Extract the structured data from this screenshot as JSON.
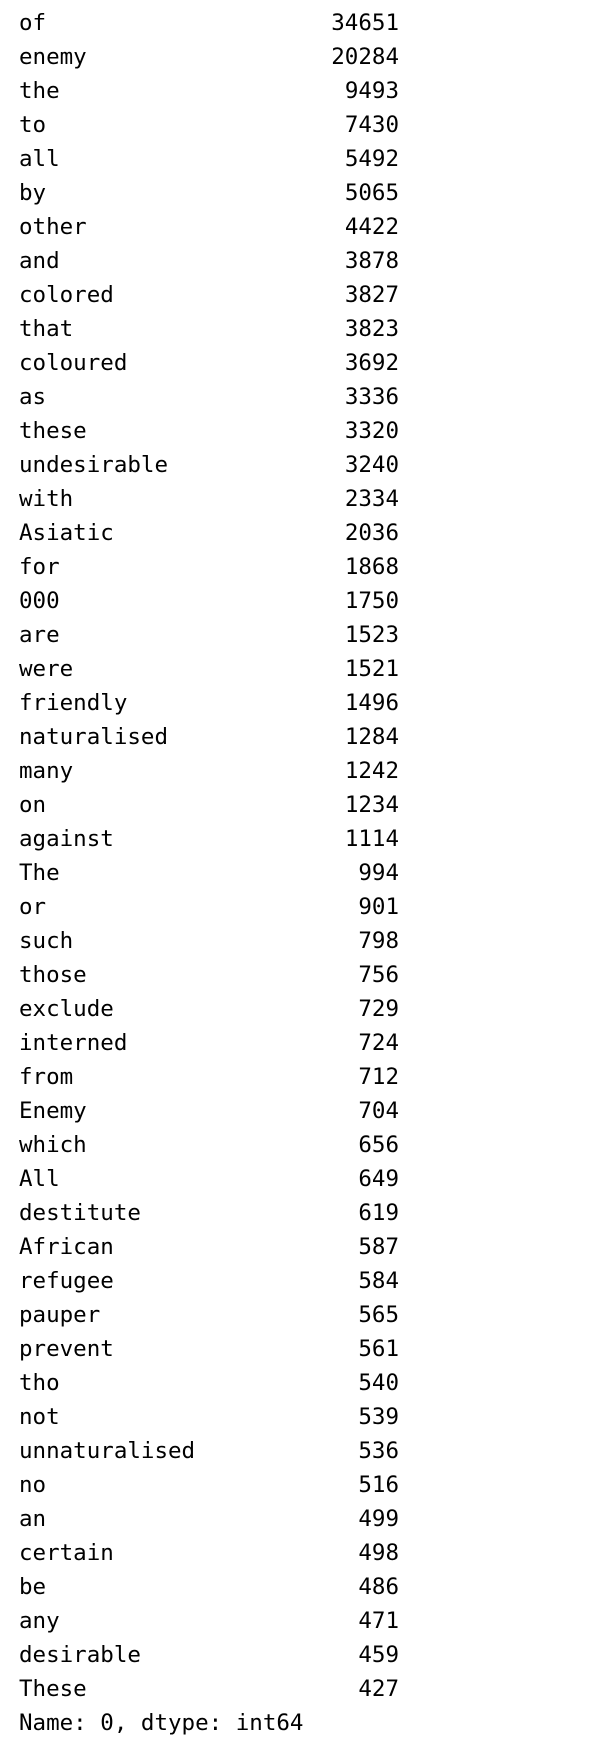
{
  "series": {
    "rows": [
      {
        "word": "of",
        "count": "34651"
      },
      {
        "word": "enemy",
        "count": "20284"
      },
      {
        "word": "the",
        "count": "9493"
      },
      {
        "word": "to",
        "count": "7430"
      },
      {
        "word": "all",
        "count": "5492"
      },
      {
        "word": "by",
        "count": "5065"
      },
      {
        "word": "other",
        "count": "4422"
      },
      {
        "word": "and",
        "count": "3878"
      },
      {
        "word": "colored",
        "count": "3827"
      },
      {
        "word": "that",
        "count": "3823"
      },
      {
        "word": "coloured",
        "count": "3692"
      },
      {
        "word": "as",
        "count": "3336"
      },
      {
        "word": "these",
        "count": "3320"
      },
      {
        "word": "undesirable",
        "count": "3240"
      },
      {
        "word": "with",
        "count": "2334"
      },
      {
        "word": "Asiatic",
        "count": "2036"
      },
      {
        "word": "for",
        "count": "1868"
      },
      {
        "word": "000",
        "count": "1750"
      },
      {
        "word": "are",
        "count": "1523"
      },
      {
        "word": "were",
        "count": "1521"
      },
      {
        "word": "friendly",
        "count": "1496"
      },
      {
        "word": "naturalised",
        "count": "1284"
      },
      {
        "word": "many",
        "count": "1242"
      },
      {
        "word": "on",
        "count": "1234"
      },
      {
        "word": "against",
        "count": "1114"
      },
      {
        "word": "The",
        "count": "994"
      },
      {
        "word": "or",
        "count": "901"
      },
      {
        "word": "such",
        "count": "798"
      },
      {
        "word": "those",
        "count": "756"
      },
      {
        "word": "exclude",
        "count": "729"
      },
      {
        "word": "interned",
        "count": "724"
      },
      {
        "word": "from",
        "count": "712"
      },
      {
        "word": "Enemy",
        "count": "704"
      },
      {
        "word": "which",
        "count": "656"
      },
      {
        "word": "All",
        "count": "649"
      },
      {
        "word": "destitute",
        "count": "619"
      },
      {
        "word": "African",
        "count": "587"
      },
      {
        "word": "refugee",
        "count": "584"
      },
      {
        "word": "pauper",
        "count": "565"
      },
      {
        "word": "prevent",
        "count": "561"
      },
      {
        "word": "tho",
        "count": "540"
      },
      {
        "word": "not",
        "count": "539"
      },
      {
        "word": "unnaturalised",
        "count": "536"
      },
      {
        "word": "no",
        "count": "516"
      },
      {
        "word": "an",
        "count": "499"
      },
      {
        "word": "certain",
        "count": "498"
      },
      {
        "word": "be",
        "count": "486"
      },
      {
        "word": "any",
        "count": "471"
      },
      {
        "word": "desirable",
        "count": "459"
      },
      {
        "word": "These",
        "count": "427"
      }
    ],
    "footer": "Name: 0, dtype: int64"
  }
}
